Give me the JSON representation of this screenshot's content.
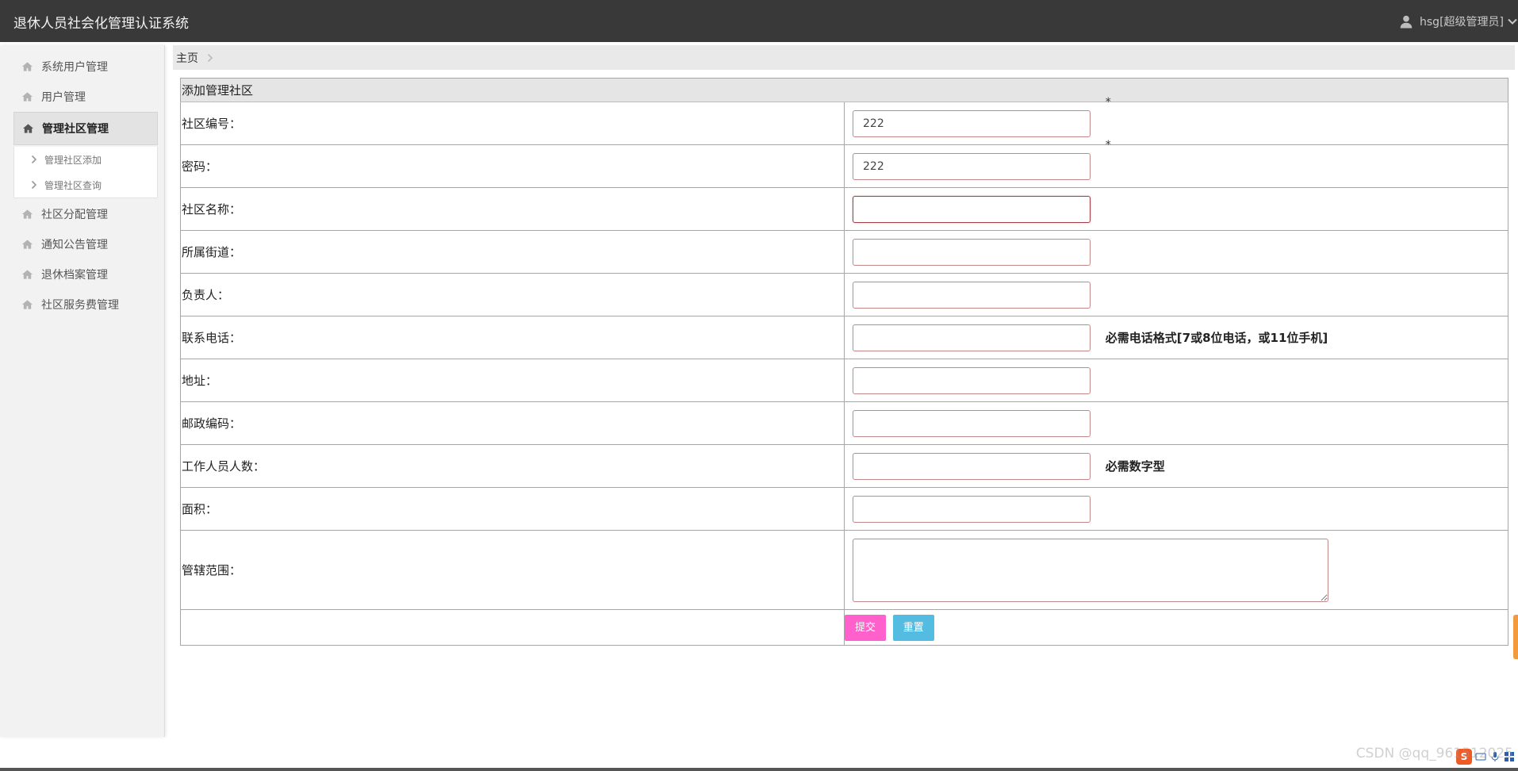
{
  "app": {
    "title": "退休人员社会化管理认证系统"
  },
  "user": {
    "label": "hsg[超级管理员]",
    "icon": "user-icon"
  },
  "sidebar": {
    "items": [
      {
        "label": "系统用户管理",
        "icon": "home-icon",
        "active": false
      },
      {
        "label": "用户管理",
        "icon": "home-icon",
        "active": false
      },
      {
        "label": "管理社区管理",
        "icon": "home-icon",
        "active": true
      },
      {
        "label": "社区分配管理",
        "icon": "home-icon",
        "active": false
      },
      {
        "label": "通知公告管理",
        "icon": "home-icon",
        "active": false
      },
      {
        "label": "退休档案管理",
        "icon": "home-icon",
        "active": false
      },
      {
        "label": "社区服务费管理",
        "icon": "home-icon",
        "active": false
      }
    ],
    "subitems": [
      {
        "label": "管理社区添加",
        "icon": "chevron-right-icon"
      },
      {
        "label": "管理社区查询",
        "icon": "chevron-right-icon"
      }
    ]
  },
  "breadcrumb": {
    "home": "主页"
  },
  "form": {
    "title": "添加管理社区",
    "fields": [
      {
        "label": "社区编号：",
        "value": "222",
        "required_mark": "*"
      },
      {
        "label": "密码：",
        "value": "222",
        "required_mark": "*"
      },
      {
        "label": "社区名称：",
        "value": ""
      },
      {
        "label": "所属街道：",
        "value": ""
      },
      {
        "label": "负责人：",
        "value": ""
      },
      {
        "label": "联系电话：",
        "value": "",
        "hint": "必需电话格式[7或8位电话，或11位手机]"
      },
      {
        "label": "地址：",
        "value": ""
      },
      {
        "label": "邮政编码：",
        "value": ""
      },
      {
        "label": "工作人员人数：",
        "value": "",
        "hint": "必需数字型"
      },
      {
        "label": "面积：",
        "value": ""
      },
      {
        "label": "管辖范围：",
        "value": ""
      }
    ],
    "submit_label": "提交",
    "reset_label": "重置"
  },
  "watermark": "CSDN @qq_961512025",
  "colors": {
    "topbar": "#393939",
    "submit": "#ff60cc",
    "reset": "#54bce0",
    "field_border": "#c1888a"
  }
}
